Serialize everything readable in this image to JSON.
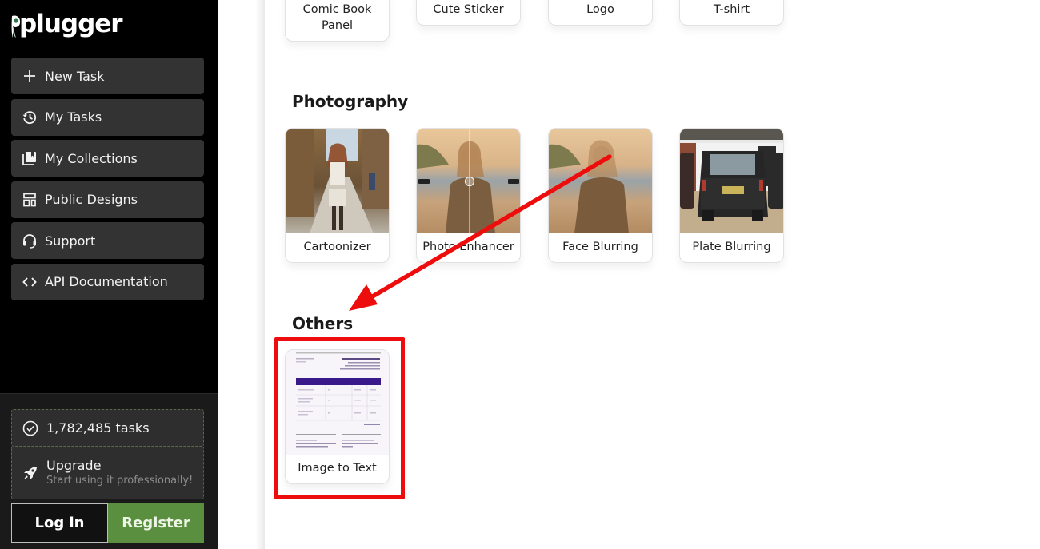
{
  "brand": {
    "name": "plugger",
    "accent_green": "#5a8f3f",
    "annotation_red": "#ee0d0d"
  },
  "sidebar": {
    "nav": [
      {
        "label": "New Task",
        "icon": "plus-icon"
      },
      {
        "label": "My Tasks",
        "icon": "history-icon"
      },
      {
        "label": "My Collections",
        "icon": "collections-icon"
      },
      {
        "label": "Public Designs",
        "icon": "layout-icon"
      },
      {
        "label": "Support",
        "icon": "headset-icon"
      },
      {
        "label": "API Documentation",
        "icon": "code-icon"
      }
    ],
    "stats": {
      "label": "1,782,485 tasks",
      "icon": "check-circle-icon"
    },
    "upgrade": {
      "title": "Upgrade",
      "subtitle": "Start using it professionally!",
      "icon": "rocket-icon"
    },
    "auth": {
      "login_label": "Log in",
      "register_label": "Register"
    }
  },
  "main": {
    "top_cards": [
      {
        "label": "Comic Book Panel"
      },
      {
        "label": "Cute Sticker"
      },
      {
        "label": "Logo"
      },
      {
        "label": "T-shirt"
      }
    ],
    "sections": [
      {
        "title": "Photography",
        "cards": [
          {
            "label": "Cartoonizer"
          },
          {
            "label": "Photo Enhancer"
          },
          {
            "label": "Face Blurring"
          },
          {
            "label": "Plate Blurring"
          }
        ]
      },
      {
        "title": "Others",
        "cards": [
          {
            "label": "Image to Text"
          }
        ]
      }
    ]
  }
}
